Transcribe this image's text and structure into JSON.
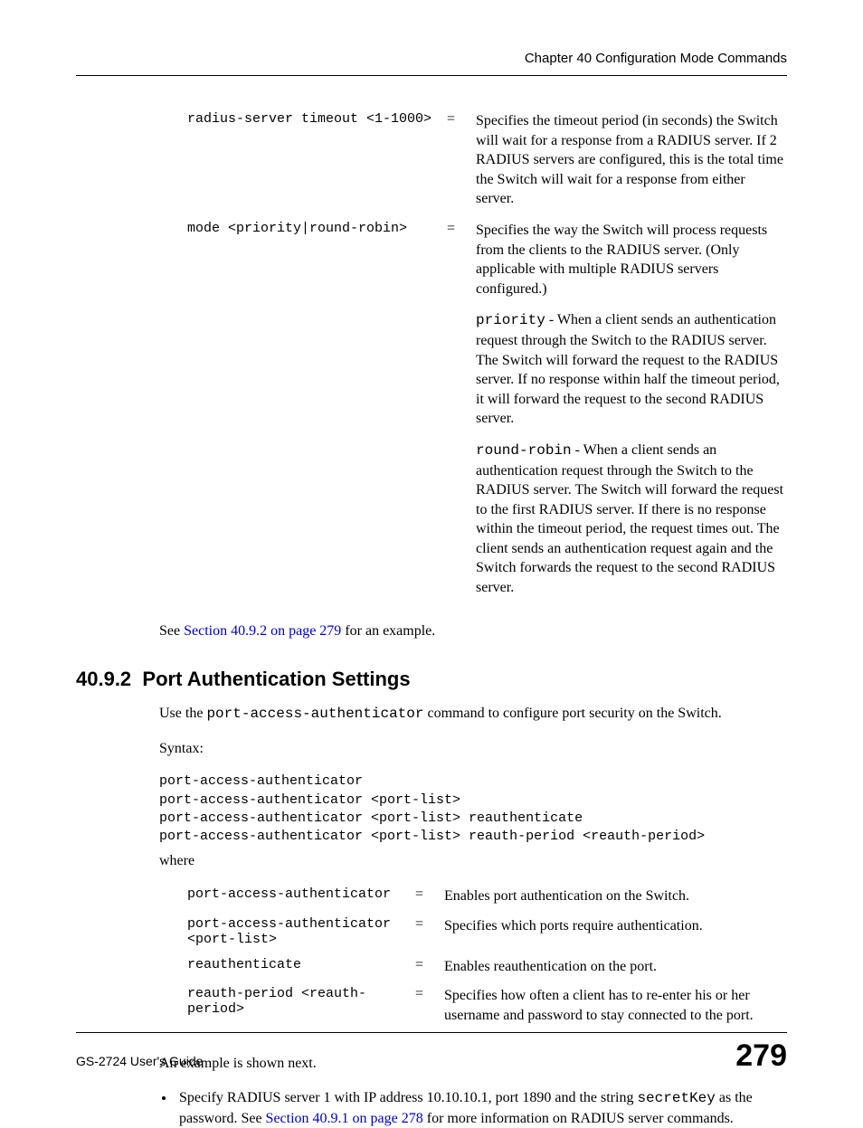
{
  "header": {
    "chapter": "Chapter 40 Configuration Mode Commands"
  },
  "table1": {
    "rows": [
      {
        "cmd": "radius-server timeout <1-1000>",
        "eq": "=",
        "desc": "Specifies the timeout period (in seconds) the Switch will wait for a response from a RADIUS server. If 2 RADIUS servers are configured, this is the total time the Switch will wait for a response from either server."
      },
      {
        "cmd": "mode <priority|round-robin>",
        "eq": "=",
        "desc": "Specifies the way the Switch will process requests from the clients to the RADIUS server. (Only applicable with multiple RADIUS servers configured.)"
      },
      {
        "cmd": "",
        "eq": "",
        "desc_prefix_mono": "priority",
        "desc_rest": " - When a client sends an authentication request through the Switch to the RADIUS server. The Switch will forward the request to the RADIUS server. If no response within half the timeout period, it will forward the request to the second RADIUS server."
      },
      {
        "cmd": "",
        "eq": "",
        "desc_prefix_mono": "round-robin",
        "desc_rest": " - When a client sends an authentication request through the Switch to the RADIUS server. The Switch will forward the request to the first RADIUS server. If there is no response within the timeout period, the request times out. The client sends an authentication request again and the Switch forwards the request to the second RADIUS server."
      }
    ]
  },
  "see_line": {
    "pre": "See ",
    "link": "Section 40.9.2 on page 279",
    "post": " for an example."
  },
  "section": {
    "number": "40.9.2",
    "title": "Port Authentication Settings"
  },
  "intro": {
    "pre": "Use the ",
    "mono": "port-access-authenticator",
    "post": " command to configure port security on the Switch."
  },
  "labels": {
    "syntax": "Syntax:",
    "where": "where"
  },
  "syntax_block": "port-access-authenticator\nport-access-authenticator <port-list>\nport-access-authenticator <port-list> reauthenticate\nport-access-authenticator <port-list> reauth-period <reauth-period>",
  "table2": {
    "rows": [
      {
        "cmd": "port-access-authenticator",
        "eq": "=",
        "desc": "Enables port authentication on the Switch."
      },
      {
        "cmd": "port-access-authenticator <port-list>",
        "eq": "=",
        "desc": "Specifies which ports require authentication."
      },
      {
        "cmd": "reauthenticate",
        "eq": "=",
        "desc": "Enables reauthentication on the port."
      },
      {
        "cmd": "reauth-period <reauth-period>",
        "eq": "=",
        "desc": "Specifies how often a client has to re-enter his or her username and password to stay connected to the port."
      }
    ]
  },
  "example_note": "An example is shown next.",
  "bullet": {
    "pre": "Specify RADIUS server 1 with IP address 10.10.10.1, port 1890 and the string ",
    "mono": "secretKey",
    "mid": " as the password. See ",
    "link": "Section 40.9.1 on page 278",
    "post": " for more information on RADIUS server commands."
  },
  "footer": {
    "guide": "GS-2724 User's Guide",
    "page": "279"
  }
}
